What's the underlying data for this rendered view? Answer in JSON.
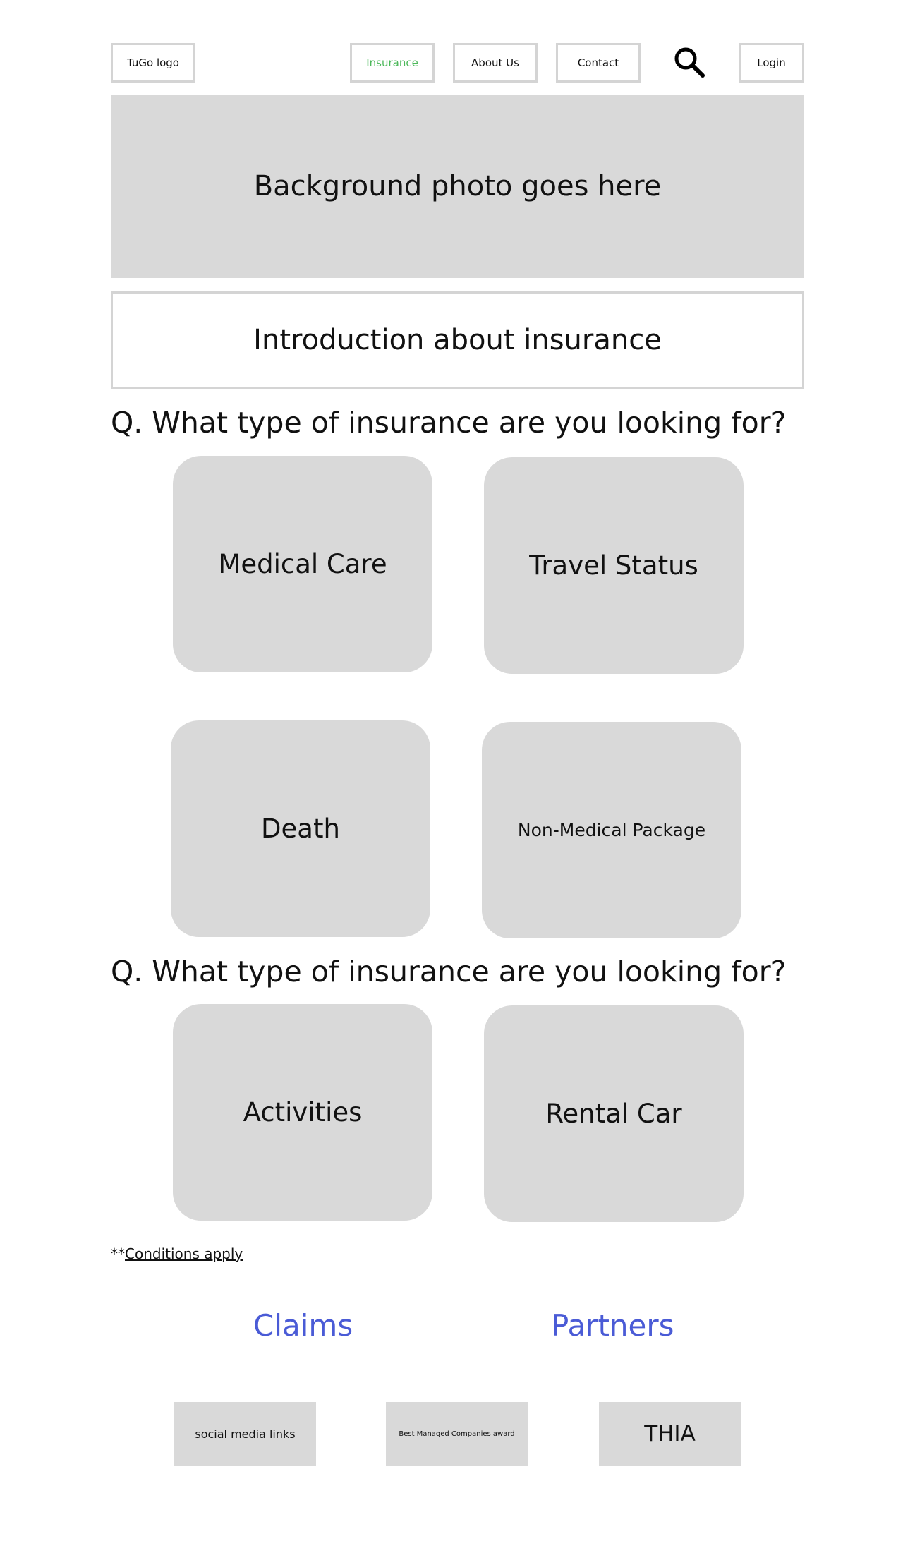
{
  "header": {
    "logo_label": "TuGo logo",
    "nav": [
      {
        "label": "Insurance",
        "active": true
      },
      {
        "label": "About Us",
        "active": false
      },
      {
        "label": "Contact",
        "active": false
      }
    ],
    "search_icon": "search-icon",
    "login_label": "Login",
    "active_color": "#4cb85a"
  },
  "hero": {
    "placeholder": "Background photo goes here"
  },
  "intro": {
    "text": "Introduction about insurance"
  },
  "section1": {
    "question": "Q. What type of insurance are you looking for?",
    "cards": [
      "Medical Care",
      "Travel Status",
      "Death",
      "Non-Medical Package"
    ]
  },
  "section2": {
    "question": "Q. What type of insurance are you looking for?",
    "cards": [
      "Activities",
      "Rental Car"
    ]
  },
  "conditions": {
    "prefix": "**",
    "link": "Conditions apply"
  },
  "footer": {
    "links": [
      "Claims",
      "Partners"
    ],
    "link_color": "#4a5bd6",
    "boxes": [
      "social media links",
      "Best Managed Companies award",
      "THIA"
    ]
  }
}
